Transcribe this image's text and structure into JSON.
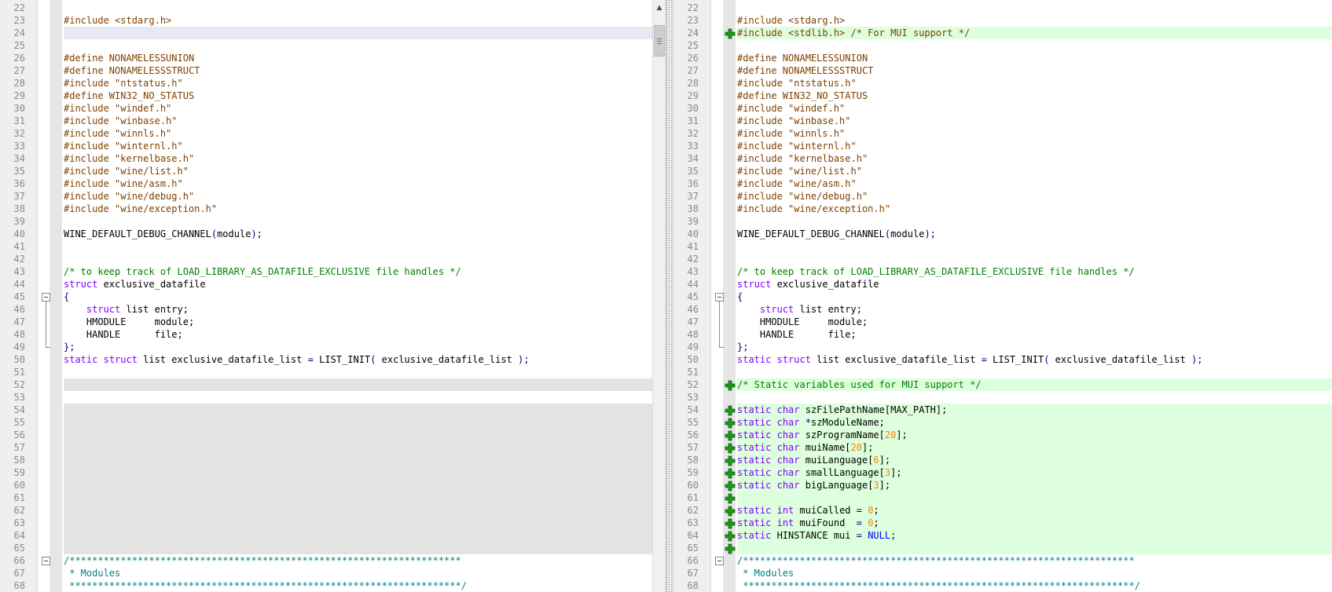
{
  "left_pane": {
    "lines": [
      {
        "n": "22",
        "segs": []
      },
      {
        "n": "23",
        "segs": [
          {
            "t": "#include <stdarg.h>",
            "c": "pp"
          }
        ]
      },
      {
        "n": "24",
        "bg": "cursor",
        "segs": []
      },
      {
        "n": "25",
        "segs": []
      },
      {
        "n": "26",
        "segs": [
          {
            "t": "#define NONAMELESSUNION",
            "c": "pp"
          }
        ]
      },
      {
        "n": "27",
        "segs": [
          {
            "t": "#define NONAMELESSSTRUCT",
            "c": "pp"
          }
        ]
      },
      {
        "n": "28",
        "segs": [
          {
            "t": "#include \"ntstatus.h\"",
            "c": "pp"
          }
        ]
      },
      {
        "n": "29",
        "segs": [
          {
            "t": "#define WIN32_NO_STATUS",
            "c": "pp"
          }
        ]
      },
      {
        "n": "30",
        "segs": [
          {
            "t": "#include \"windef.h\"",
            "c": "pp"
          }
        ]
      },
      {
        "n": "31",
        "segs": [
          {
            "t": "#include \"winbase.h\"",
            "c": "pp"
          }
        ]
      },
      {
        "n": "32",
        "segs": [
          {
            "t": "#include \"winnls.h\"",
            "c": "pp"
          }
        ]
      },
      {
        "n": "33",
        "segs": [
          {
            "t": "#include \"winternl.h\"",
            "c": "pp"
          }
        ]
      },
      {
        "n": "34",
        "segs": [
          {
            "t": "#include \"kernelbase.h\"",
            "c": "pp"
          }
        ]
      },
      {
        "n": "35",
        "segs": [
          {
            "t": "#include \"wine/list.h\"",
            "c": "pp"
          }
        ]
      },
      {
        "n": "36",
        "segs": [
          {
            "t": "#include \"wine/asm.h\"",
            "c": "pp"
          }
        ]
      },
      {
        "n": "37",
        "segs": [
          {
            "t": "#include \"wine/debug.h\"",
            "c": "pp"
          }
        ]
      },
      {
        "n": "38",
        "segs": [
          {
            "t": "#include \"wine/exception.h\"",
            "c": "pp"
          }
        ]
      },
      {
        "n": "39",
        "segs": []
      },
      {
        "n": "40",
        "segs": [
          {
            "t": "WINE_DEFAULT_DEBUG_CHANNEL",
            "c": ""
          },
          {
            "t": "(",
            "c": "op"
          },
          {
            "t": "module",
            "c": ""
          },
          {
            "t": ");",
            "c": "op"
          }
        ]
      },
      {
        "n": "41",
        "segs": []
      },
      {
        "n": "42",
        "segs": []
      },
      {
        "n": "43",
        "segs": [
          {
            "t": "/* to keep track of LOAD_LIBRARY_AS_DATAFILE_EXCLUSIVE file handles */",
            "c": "cm"
          }
        ]
      },
      {
        "n": "44",
        "segs": [
          {
            "t": "struct",
            "c": "kw"
          },
          {
            "t": " exclusive_datafile",
            "c": ""
          }
        ]
      },
      {
        "n": "45",
        "fold": "open",
        "segs": [
          {
            "t": "{",
            "c": "op"
          }
        ]
      },
      {
        "n": "46",
        "segs": [
          {
            "t": "    ",
            "c": ""
          },
          {
            "t": "struct",
            "c": "kw"
          },
          {
            "t": " list entry;",
            "c": ""
          }
        ]
      },
      {
        "n": "47",
        "segs": [
          {
            "t": "    HMODULE     module;",
            "c": ""
          }
        ]
      },
      {
        "n": "48",
        "segs": [
          {
            "t": "    HANDLE      file;",
            "c": ""
          }
        ]
      },
      {
        "n": "49",
        "fold": "end",
        "segs": [
          {
            "t": "};",
            "c": "op"
          }
        ]
      },
      {
        "n": "50",
        "segs": [
          {
            "t": "static",
            "c": "kw"
          },
          {
            "t": " ",
            "c": ""
          },
          {
            "t": "struct",
            "c": "kw"
          },
          {
            "t": " list exclusive_datafile_list ",
            "c": ""
          },
          {
            "t": "=",
            "c": "op"
          },
          {
            "t": " LIST_INIT",
            "c": ""
          },
          {
            "t": "(",
            "c": "op"
          },
          {
            "t": " exclusive_datafile_list ",
            "c": ""
          },
          {
            "t": ");",
            "c": "op"
          }
        ]
      },
      {
        "n": "51",
        "segs": []
      },
      {
        "n": "52",
        "bg": "empty",
        "segs": []
      },
      {
        "n": "53",
        "segs": []
      },
      {
        "n": "54",
        "bg": "empty",
        "segs": []
      },
      {
        "n": "55",
        "bg": "empty",
        "segs": []
      },
      {
        "n": "56",
        "bg": "empty",
        "segs": []
      },
      {
        "n": "57",
        "bg": "empty",
        "segs": []
      },
      {
        "n": "58",
        "bg": "empty",
        "segs": []
      },
      {
        "n": "59",
        "bg": "empty",
        "segs": []
      },
      {
        "n": "60",
        "bg": "empty",
        "segs": []
      },
      {
        "n": "61",
        "bg": "empty",
        "segs": []
      },
      {
        "n": "62",
        "bg": "empty",
        "segs": []
      },
      {
        "n": "63",
        "bg": "empty",
        "segs": []
      },
      {
        "n": "64",
        "bg": "empty",
        "segs": []
      },
      {
        "n": "65",
        "bg": "empty",
        "segs": []
      },
      {
        "n": "66",
        "fold": "open",
        "segs": [
          {
            "t": "/*********************************************************************",
            "c": "cmb"
          }
        ]
      },
      {
        "n": "67",
        "segs": [
          {
            "t": " * Modules",
            "c": "cmb"
          }
        ]
      },
      {
        "n": "68",
        "segs": [
          {
            "t": " *********************************************************************/",
            "c": "cmb"
          }
        ]
      }
    ]
  },
  "right_pane": {
    "lines": [
      {
        "n": "22",
        "segs": []
      },
      {
        "n": "23",
        "segs": [
          {
            "t": "#include <stdarg.h>",
            "c": "pp"
          }
        ]
      },
      {
        "n": "24",
        "bg": "added",
        "mark": "added",
        "segs": [
          {
            "t": "#include <stdlib.h> /* For MUI support */",
            "c": "pp"
          }
        ]
      },
      {
        "n": "25",
        "segs": []
      },
      {
        "n": "26",
        "segs": [
          {
            "t": "#define NONAMELESSUNION",
            "c": "pp"
          }
        ]
      },
      {
        "n": "27",
        "segs": [
          {
            "t": "#define NONAMELESSSTRUCT",
            "c": "pp"
          }
        ]
      },
      {
        "n": "28",
        "segs": [
          {
            "t": "#include \"ntstatus.h\"",
            "c": "pp"
          }
        ]
      },
      {
        "n": "29",
        "segs": [
          {
            "t": "#define WIN32_NO_STATUS",
            "c": "pp"
          }
        ]
      },
      {
        "n": "30",
        "segs": [
          {
            "t": "#include \"windef.h\"",
            "c": "pp"
          }
        ]
      },
      {
        "n": "31",
        "segs": [
          {
            "t": "#include \"winbase.h\"",
            "c": "pp"
          }
        ]
      },
      {
        "n": "32",
        "segs": [
          {
            "t": "#include \"winnls.h\"",
            "c": "pp"
          }
        ]
      },
      {
        "n": "33",
        "segs": [
          {
            "t": "#include \"winternl.h\"",
            "c": "pp"
          }
        ]
      },
      {
        "n": "34",
        "segs": [
          {
            "t": "#include \"kernelbase.h\"",
            "c": "pp"
          }
        ]
      },
      {
        "n": "35",
        "segs": [
          {
            "t": "#include \"wine/list.h\"",
            "c": "pp"
          }
        ]
      },
      {
        "n": "36",
        "segs": [
          {
            "t": "#include \"wine/asm.h\"",
            "c": "pp"
          }
        ]
      },
      {
        "n": "37",
        "segs": [
          {
            "t": "#include \"wine/debug.h\"",
            "c": "pp"
          }
        ]
      },
      {
        "n": "38",
        "segs": [
          {
            "t": "#include \"wine/exception.h\"",
            "c": "pp"
          }
        ]
      },
      {
        "n": "39",
        "segs": []
      },
      {
        "n": "40",
        "segs": [
          {
            "t": "WINE_DEFAULT_DEBUG_CHANNEL",
            "c": ""
          },
          {
            "t": "(",
            "c": "op"
          },
          {
            "t": "module",
            "c": ""
          },
          {
            "t": ");",
            "c": "op"
          }
        ]
      },
      {
        "n": "41",
        "segs": []
      },
      {
        "n": "42",
        "segs": []
      },
      {
        "n": "43",
        "segs": [
          {
            "t": "/* to keep track of LOAD_LIBRARY_AS_DATAFILE_EXCLUSIVE file handles */",
            "c": "cm"
          }
        ]
      },
      {
        "n": "44",
        "segs": [
          {
            "t": "struct",
            "c": "kw"
          },
          {
            "t": " exclusive_datafile",
            "c": ""
          }
        ]
      },
      {
        "n": "45",
        "fold": "open",
        "segs": [
          {
            "t": "{",
            "c": "op"
          }
        ]
      },
      {
        "n": "46",
        "segs": [
          {
            "t": "    ",
            "c": ""
          },
          {
            "t": "struct",
            "c": "kw"
          },
          {
            "t": " list entry;",
            "c": ""
          }
        ]
      },
      {
        "n": "47",
        "segs": [
          {
            "t": "    HMODULE     module;",
            "c": ""
          }
        ]
      },
      {
        "n": "48",
        "segs": [
          {
            "t": "    HANDLE      file;",
            "c": ""
          }
        ]
      },
      {
        "n": "49",
        "fold": "end",
        "segs": [
          {
            "t": "};",
            "c": "op"
          }
        ]
      },
      {
        "n": "50",
        "segs": [
          {
            "t": "static",
            "c": "kw"
          },
          {
            "t": " ",
            "c": ""
          },
          {
            "t": "struct",
            "c": "kw"
          },
          {
            "t": " list exclusive_datafile_list ",
            "c": ""
          },
          {
            "t": "=",
            "c": "op"
          },
          {
            "t": " LIST_INIT",
            "c": ""
          },
          {
            "t": "(",
            "c": "op"
          },
          {
            "t": " exclusive_datafile_list ",
            "c": ""
          },
          {
            "t": ");",
            "c": "op"
          }
        ]
      },
      {
        "n": "51",
        "segs": []
      },
      {
        "n": "52",
        "bg": "added",
        "mark": "added",
        "segs": [
          {
            "t": "/* Static variables used for MUI support */",
            "c": "cm"
          }
        ]
      },
      {
        "n": "53",
        "segs": []
      },
      {
        "n": "54",
        "bg": "added",
        "mark": "added",
        "segs": [
          {
            "t": "static",
            "c": "kw"
          },
          {
            "t": " ",
            "c": ""
          },
          {
            "t": "char",
            "c": "kw"
          },
          {
            "t": " szFilePathName[MAX_PATH];",
            "c": ""
          }
        ]
      },
      {
        "n": "55",
        "bg": "added",
        "mark": "added",
        "segs": [
          {
            "t": "static",
            "c": "kw"
          },
          {
            "t": " ",
            "c": ""
          },
          {
            "t": "char",
            "c": "kw"
          },
          {
            "t": " ",
            "c": ""
          },
          {
            "t": "*",
            "c": "op"
          },
          {
            "t": "szModuleName;",
            "c": ""
          }
        ]
      },
      {
        "n": "56",
        "bg": "added",
        "mark": "added",
        "segs": [
          {
            "t": "static",
            "c": "kw"
          },
          {
            "t": " ",
            "c": ""
          },
          {
            "t": "char",
            "c": "kw"
          },
          {
            "t": " szProgramName[",
            "c": ""
          },
          {
            "t": "20",
            "c": "num"
          },
          {
            "t": "];",
            "c": ""
          }
        ]
      },
      {
        "n": "57",
        "bg": "added",
        "mark": "added",
        "segs": [
          {
            "t": "static",
            "c": "kw"
          },
          {
            "t": " ",
            "c": ""
          },
          {
            "t": "char",
            "c": "kw"
          },
          {
            "t": " muiName[",
            "c": ""
          },
          {
            "t": "20",
            "c": "num"
          },
          {
            "t": "];",
            "c": ""
          }
        ]
      },
      {
        "n": "58",
        "bg": "added",
        "mark": "added",
        "segs": [
          {
            "t": "static",
            "c": "kw"
          },
          {
            "t": " ",
            "c": ""
          },
          {
            "t": "char",
            "c": "kw"
          },
          {
            "t": " muiLanguage[",
            "c": ""
          },
          {
            "t": "6",
            "c": "num"
          },
          {
            "t": "];",
            "c": ""
          }
        ]
      },
      {
        "n": "59",
        "bg": "added",
        "mark": "added",
        "segs": [
          {
            "t": "static",
            "c": "kw"
          },
          {
            "t": " ",
            "c": ""
          },
          {
            "t": "char",
            "c": "kw"
          },
          {
            "t": " smallLanguage[",
            "c": ""
          },
          {
            "t": "3",
            "c": "num"
          },
          {
            "t": "];",
            "c": ""
          }
        ]
      },
      {
        "n": "60",
        "bg": "added",
        "mark": "added",
        "segs": [
          {
            "t": "static",
            "c": "kw"
          },
          {
            "t": " ",
            "c": ""
          },
          {
            "t": "char",
            "c": "kw"
          },
          {
            "t": " bigLanguage[",
            "c": ""
          },
          {
            "t": "3",
            "c": "num"
          },
          {
            "t": "];",
            "c": ""
          }
        ]
      },
      {
        "n": "61",
        "bg": "added",
        "mark": "added",
        "segs": []
      },
      {
        "n": "62",
        "bg": "added",
        "mark": "added",
        "segs": [
          {
            "t": "static",
            "c": "kw"
          },
          {
            "t": " ",
            "c": ""
          },
          {
            "t": "int",
            "c": "kw"
          },
          {
            "t": " muiCalled ",
            "c": ""
          },
          {
            "t": "=",
            "c": "op"
          },
          {
            "t": " ",
            "c": ""
          },
          {
            "t": "0",
            "c": "num"
          },
          {
            "t": ";",
            "c": ""
          }
        ]
      },
      {
        "n": "63",
        "bg": "added",
        "mark": "added",
        "segs": [
          {
            "t": "static",
            "c": "kw"
          },
          {
            "t": " ",
            "c": ""
          },
          {
            "t": "int",
            "c": "kw"
          },
          {
            "t": " muiFound  ",
            "c": ""
          },
          {
            "t": "=",
            "c": "op"
          },
          {
            "t": " ",
            "c": ""
          },
          {
            "t": "0",
            "c": "num"
          },
          {
            "t": ";",
            "c": ""
          }
        ]
      },
      {
        "n": "64",
        "bg": "added",
        "mark": "added",
        "segs": [
          {
            "t": "static",
            "c": "kw"
          },
          {
            "t": " HINSTANCE mui ",
            "c": ""
          },
          {
            "t": "=",
            "c": "op"
          },
          {
            "t": " ",
            "c": ""
          },
          {
            "t": "NULL",
            "c": "bl"
          },
          {
            "t": ";",
            "c": ""
          }
        ]
      },
      {
        "n": "65",
        "bg": "added",
        "mark": "added",
        "segs": []
      },
      {
        "n": "66",
        "fold": "open",
        "segs": [
          {
            "t": "/*********************************************************************",
            "c": "cmb"
          }
        ]
      },
      {
        "n": "67",
        "segs": [
          {
            "t": " * Modules",
            "c": "cmb"
          }
        ]
      },
      {
        "n": "68",
        "segs": [
          {
            "t": " *********************************************************************/",
            "c": "cmb"
          }
        ]
      }
    ]
  },
  "scrollbar": {
    "up_arrow_icon": "triangle-up-icon"
  },
  "colors": {
    "added_bg": "#ddffdd",
    "cursor_bg": "#e8e8f2",
    "empty_bg": "#e3e3e3",
    "plus_icon": "#1a9a1a"
  }
}
